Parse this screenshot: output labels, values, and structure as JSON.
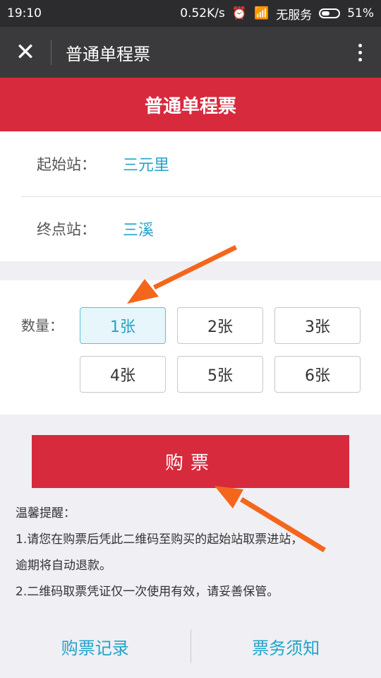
{
  "status_bar": {
    "time": "19:10",
    "network_speed": "0.52K/s",
    "carrier": "无服务",
    "battery": "51%",
    "battery_level": 0.51
  },
  "app_bar": {
    "close_icon": "close-icon",
    "title": "普通单程票",
    "more_icon": "more-vertical-icon"
  },
  "banner": {
    "title": "普通单程票"
  },
  "stations": {
    "start_label": "起始站：",
    "start_value": "三元里",
    "end_label": "终点站：",
    "end_value": "三溪"
  },
  "quantity": {
    "label": "数量：",
    "options": [
      "1张",
      "2张",
      "3张",
      "4张",
      "5张",
      "6张"
    ],
    "selected": "1张"
  },
  "buy_button": {
    "label": "购票"
  },
  "tips": {
    "title": "温馨提醒：",
    "line1": "1.请您在购票后凭此二维码至购买的起始站取票进站，",
    "line2": "逾期将自动退款。",
    "line3": "2.二维码取票凭证仅一次使用有效，请妥善保管。"
  },
  "footer": {
    "records_link": "购票记录",
    "notice_link": "票务须知"
  },
  "colors": {
    "accent_red": "#d72a3d",
    "link_blue": "#23a3c9",
    "annotation_arrow": "#f4661b"
  }
}
